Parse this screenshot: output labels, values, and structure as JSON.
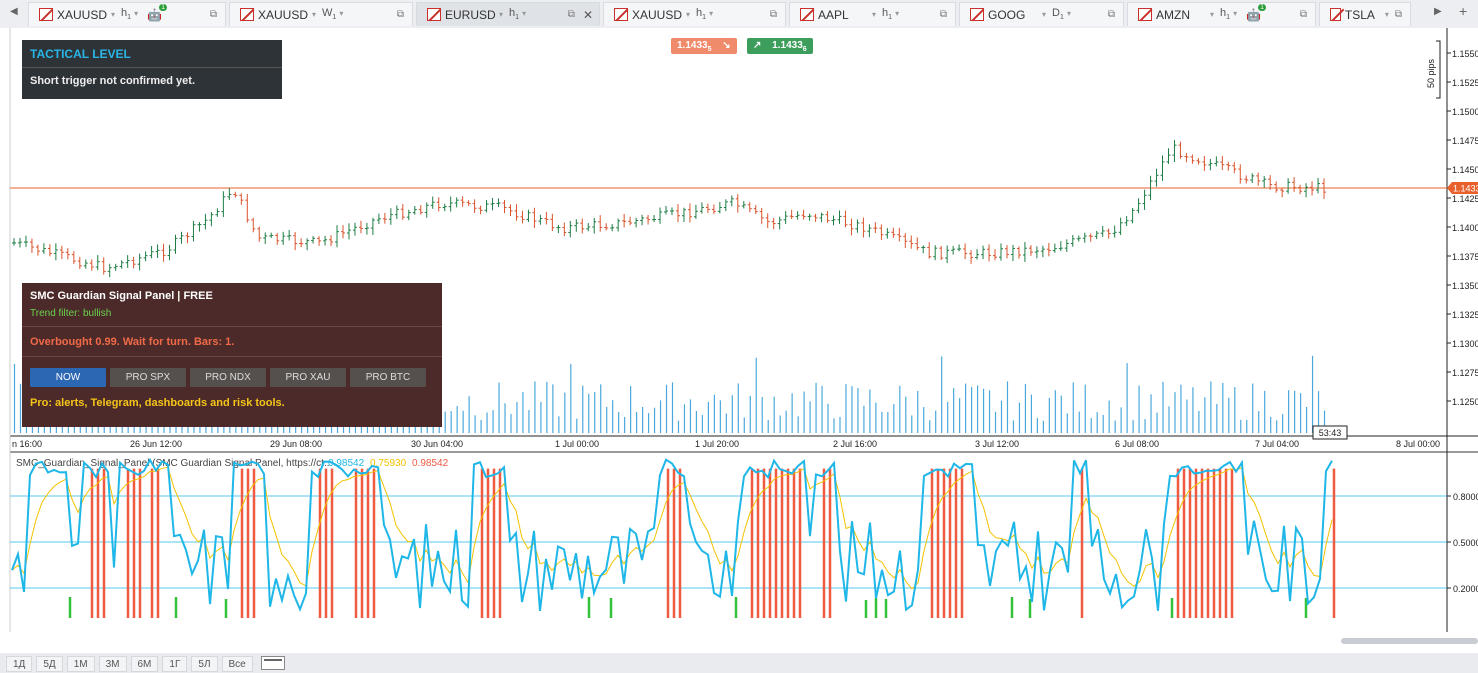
{
  "tabs": [
    {
      "symbol": "XAUUSD",
      "tf": "h",
      "tf_sub": "1",
      "bot_badge": "1",
      "active": false,
      "closable": false,
      "width": 198
    },
    {
      "symbol": "XAUUSD",
      "tf": "W",
      "tf_sub": "1",
      "active": false,
      "closable": false,
      "width": 184
    },
    {
      "symbol": "EURUSD",
      "tf": "h",
      "tf_sub": "1",
      "active": true,
      "closable": true,
      "width": 184
    },
    {
      "symbol": "XAUUSD",
      "tf": "h",
      "tf_sub": "1",
      "active": false,
      "closable": false,
      "width": 183
    },
    {
      "symbol": "AAPL",
      "tf": "h",
      "tf_sub": "1",
      "active": false,
      "closable": false,
      "width": 167
    },
    {
      "symbol": "GOOG",
      "tf": "D",
      "tf_sub": "1",
      "active": false,
      "closable": false,
      "width": 165
    },
    {
      "symbol": "AMZN",
      "tf": "h",
      "tf_sub": "1",
      "bot_badge": "1",
      "active": false,
      "closable": false,
      "width": 189
    },
    {
      "symbol": "TSLA",
      "tf": "",
      "tf_sub": "",
      "active": false,
      "closable": false,
      "width": 92
    }
  ],
  "tactical_panel": {
    "title": "TACTICAL LEVEL",
    "message": "Short trigger not confirmed yet."
  },
  "signal_panel": {
    "title": "SMC Guardian Signal Panel | FREE",
    "trend": "Trend filter: bullish",
    "warning": "Overbought 0.99. Wait for turn. Bars: 1.",
    "buttons": [
      "NOW",
      "PRO SPX",
      "PRO NDX",
      "PRO XAU",
      "PRO BTC"
    ],
    "promo": "Pro: alerts, Telegram, dashboards and risk tools."
  },
  "quote": {
    "sell_main": "1.1433",
    "sell_sub": "5",
    "buy_main": "1.1433",
    "buy_sub": "6"
  },
  "price_axis": {
    "labels": [
      "1.15500",
      "1.15250",
      "1.15000",
      "1.14750",
      "1.14500",
      "1.14250",
      "1.14000",
      "1.13750",
      "1.13500",
      "1.13250",
      "1.13000",
      "1.12750",
      "1.12500"
    ],
    "current": "1.1433",
    "pips_label": "50 pips"
  },
  "time_axis": {
    "labels": [
      "n 16:00",
      "26 Jun 12:00",
      "29 Jun 08:00",
      "30 Jun 04:00",
      "1 Jul 00:00",
      "1 Jul 20:00",
      "2 Jul 16:00",
      "3 Jul 12:00",
      "6 Jul 08:00",
      "7 Jul 04:00",
      "8 Jul 00:00"
    ],
    "countdown": "53:43"
  },
  "indicator": {
    "title": "SMC_Guardian_Signal_Panel (SMC Guardian Signal Panel, https://ct...",
    "value1": "0.98542",
    "value2": "0.75930",
    "value3": "0.98542",
    "axis_labels": [
      "0.80000",
      "0.50000",
      "0.20000"
    ],
    "colors": {
      "line1": "#1fb6e8",
      "line2": "#f2c200",
      "overbought": "#f05a40",
      "oversold": "#34c23a"
    }
  },
  "periods": [
    "1Д",
    "5Д",
    "1М",
    "3М",
    "6М",
    "1Г",
    "5Л",
    "Все"
  ],
  "colors": {
    "bull": "#1e7d45",
    "bear": "#d9532c",
    "price_line": "#e8612c",
    "volume": "#4aa8dc"
  }
}
